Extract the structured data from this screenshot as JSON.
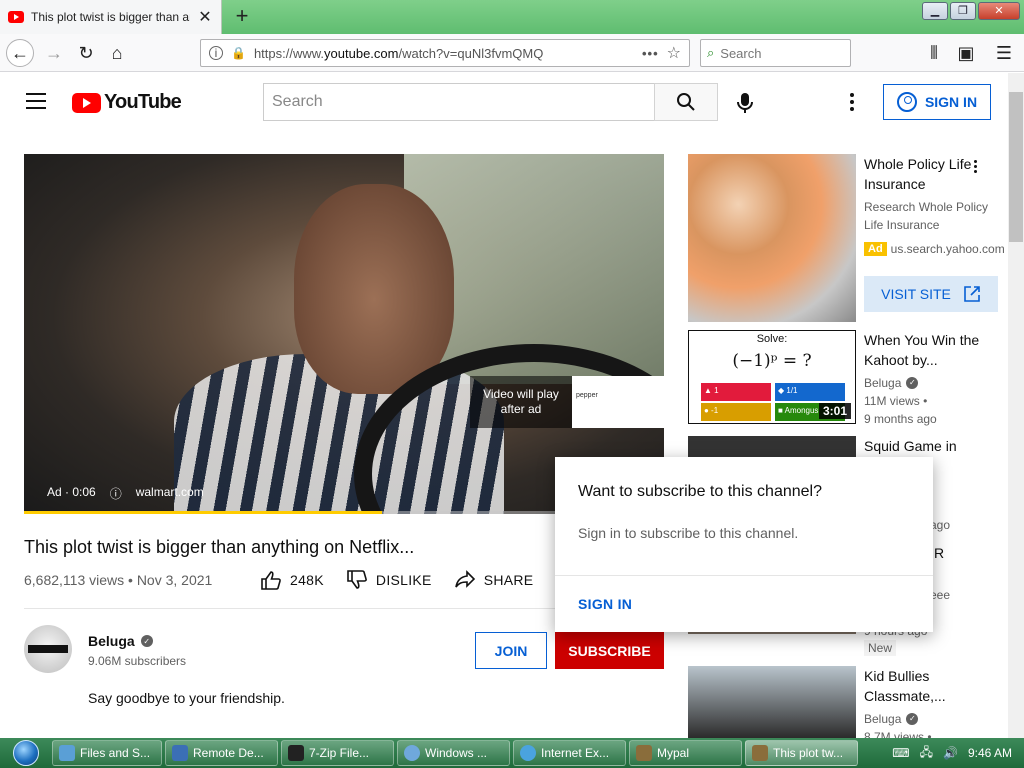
{
  "browser": {
    "tab_title": "This plot twist is bigger than any",
    "url_prefix": "https://www.",
    "url_domain": "youtube.com",
    "url_path": "/watch?v=quNl3fvmQMQ",
    "search_placeholder": "Search"
  },
  "youtube": {
    "logo_text": "YouTube",
    "search_placeholder": "Search",
    "sign_in_label": "SIGN IN"
  },
  "video": {
    "ad_label": "Ad · 0:06",
    "ad_site": "walmart.com",
    "play_after_ad": "Video will play after ad",
    "thumb_brand": "pepper",
    "ad_progress": 0.56,
    "title": "This plot twist is bigger than anything on Netflix...",
    "meta": "6,682,113 views • Nov 3, 2021",
    "like_count": "248K",
    "dislike_label": "DISLIKE",
    "share_label": "SHARE"
  },
  "channel": {
    "name": "Beluga",
    "subscribers": "9.06M subscribers",
    "join_label": "JOIN",
    "subscribe_label": "SUBSCRIBE",
    "description": "Say goodbye to your friendship."
  },
  "sidebar": {
    "ad": {
      "title": "Whole Policy Life Insurance",
      "subtitle": "Research Whole Policy Life Insurance",
      "badge": "Ad",
      "domain": "us.search.yahoo.com",
      "visit_label": "VISIT SITE"
    },
    "items": [
      {
        "title": "When You Win the Kahoot by...",
        "channel": "Beluga",
        "views": "11M views •",
        "age": "9 months ago",
        "duration": "3:01"
      },
      {
        "title": "Squid Game in",
        "channel": "",
        "views": "",
        "age": "ago",
        "duration": ""
      },
      {
        "title": "R",
        "channel": "",
        "views": "eee",
        "age": "9 hours ago",
        "badge": "New"
      },
      {
        "title": "Kid Bullies Classmate,...",
        "channel": "Beluga",
        "views": "8.7M views •"
      }
    ],
    "kahoot": {
      "solve": "Solve:",
      "equation": "(−1)ᵖ = ?",
      "a1": "▲ 1",
      "a2": "◆ 1/1",
      "a3": "● -1",
      "a4": "■ Amongus"
    }
  },
  "popup": {
    "title": "Want to subscribe to this channel?",
    "body": "Sign in to subscribe to this channel.",
    "sign_in": "SIGN IN"
  },
  "taskbar": {
    "items": [
      "Files and S...",
      "Remote De...",
      "7-Zip File...",
      "Windows ...",
      "Internet Ex...",
      "Mypal",
      "This plot tw..."
    ],
    "clock": "9:46 AM"
  },
  "colors": {
    "youtube_red": "#ff0000",
    "link_blue": "#065fd4",
    "subscribe_red": "#cc0000",
    "ad_yellow": "#f9c100"
  }
}
